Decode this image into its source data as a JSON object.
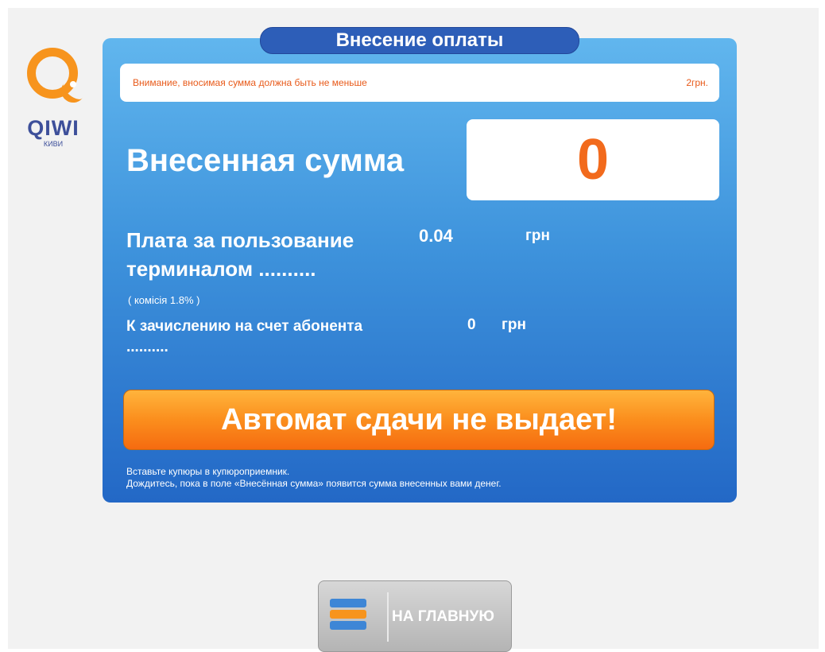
{
  "logo": {
    "text": "QIWI",
    "subtext": "КИВИ"
  },
  "panel": {
    "title": "Внесение оплаты",
    "warning": {
      "text": "Внимание, вносимая сумма должна быть не меньше",
      "amount": "2грн."
    },
    "deposited": {
      "label": "Внесенная сумма",
      "value": "0"
    },
    "fee": {
      "label": "Плата за пользование терминалом ..........",
      "value": "0.04",
      "currency": "грн"
    },
    "commission": "( комісія 1.8% )",
    "credit": {
      "label": "К зачислению на счет абонента ..........",
      "value": "0",
      "currency": "грн"
    },
    "no_change_button": "Автомат сдачи не выдает!",
    "hint_line1": "Вставьте купюры в купюроприемник.",
    "hint_line2": "Дождитесь, пока в поле «Внесённая сумма» появится сумма внесенных вами денег."
  },
  "home_button": {
    "label": "НА ГЛАВНУЮ"
  },
  "colors": {
    "panel_top": "#61b6ee",
    "panel_bottom": "#2368c6",
    "accent_orange": "#f26a1c",
    "logo_orange": "#f7941d",
    "logo_blue": "#3d4f9a"
  }
}
